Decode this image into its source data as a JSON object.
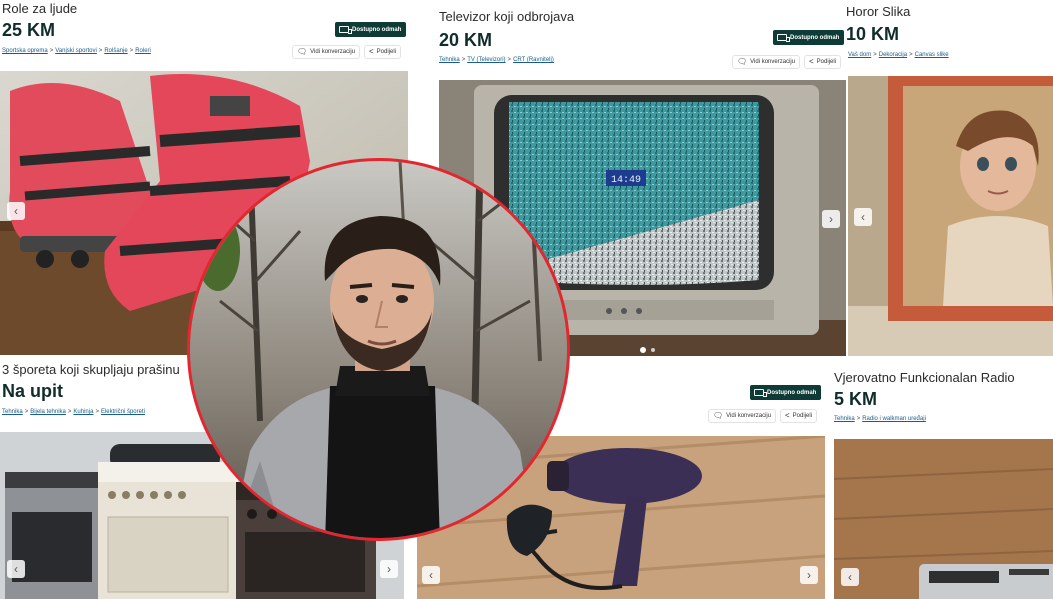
{
  "cards": [
    {
      "id": "role",
      "title": "Role za ljude",
      "price": "25 KM",
      "badge": "Dostupno odmah",
      "crumbs": [
        "Sportska oprema",
        "Vanjski sportovi",
        "Rolšanje",
        "Roleri"
      ],
      "actions": {
        "chat": "Vidi konverzaciju",
        "share": "Podijeli"
      }
    },
    {
      "id": "televizor",
      "title": "Televizor koji odbrojava",
      "price": "20 KM",
      "badge": "Dostupno odmah",
      "crumbs": [
        "Tehnika",
        "TV (Televizori)",
        "CRT (Ravnitelj)"
      ],
      "actions": {
        "chat": "Vidi konverzaciju",
        "share": "Podijeli"
      },
      "screen_text": "14:49"
    },
    {
      "id": "horor",
      "title": "Horor Slika",
      "price": "10 KM",
      "crumbs": [
        "Vaš dom",
        "Dekoracija",
        "Canvas slike"
      ]
    },
    {
      "id": "sporeti",
      "title": "3 šporeta koji skupljaju prašinu",
      "price": "Na upit",
      "crumbs": [
        "Tehnika",
        "Bijela tehnika",
        "Kuhinja",
        "Električni šporeti"
      ]
    },
    {
      "id": "fen",
      "badge": "Dostupno odmah",
      "actions": {
        "chat": "Vidi konverzaciju",
        "share": "Podijeli"
      }
    },
    {
      "id": "radio",
      "title": "Vjerovatno Funkcionalan Radio",
      "price": "5 KM",
      "crumbs": [
        "Tehnika",
        "Radio i walkman uređaji"
      ]
    }
  ],
  "colors": {
    "badge": "#0f3b36",
    "price": "#0f2d2a",
    "crumb_link": "#1a5c8c",
    "portrait_ring": "#e4262f"
  },
  "icons": {
    "prev": "chevron-left-icon",
    "next": "chevron-right-icon",
    "chat": "chat-bubble-icon",
    "share": "share-icon",
    "delivery": "truck-icon"
  }
}
